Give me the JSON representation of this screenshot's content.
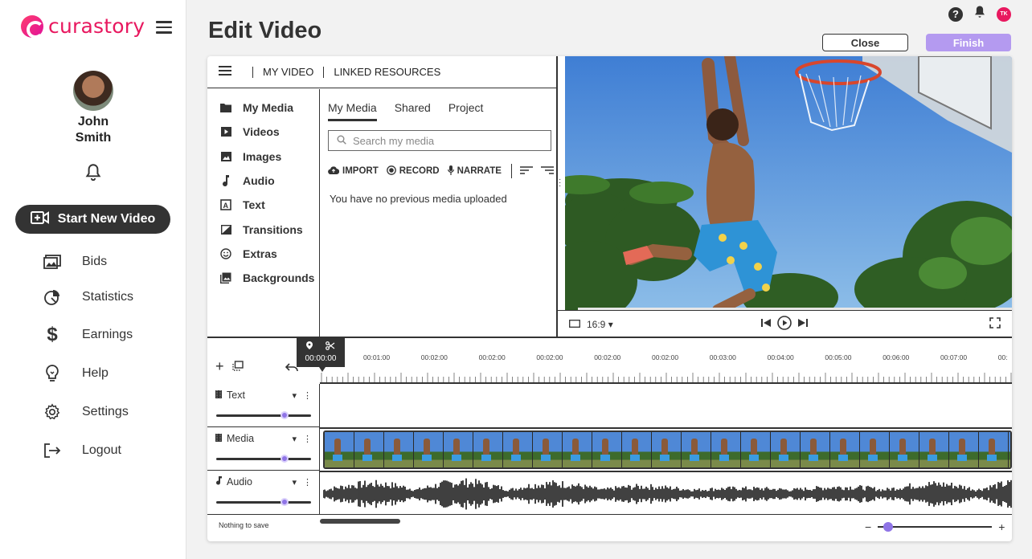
{
  "app": {
    "brand": "curastory",
    "page_title": "Edit Video",
    "brand_color": "#e8185f",
    "accent_color": "#b49af0"
  },
  "user": {
    "first_name": "John",
    "last_name": "Smith",
    "initials": "TK"
  },
  "sidebar": {
    "start_button": "Start New Video",
    "items": [
      {
        "label": "Bids",
        "icon": "images-icon"
      },
      {
        "label": "Statistics",
        "icon": "pie-chart-icon"
      },
      {
        "label": "Earnings",
        "icon": "dollar-icon"
      },
      {
        "label": "Help",
        "icon": "lightbulb-icon"
      },
      {
        "label": "Settings",
        "icon": "gear-icon"
      },
      {
        "label": "Logout",
        "icon": "logout-icon"
      }
    ]
  },
  "header": {
    "close_label": "Close",
    "finish_label": "Finish"
  },
  "media_panel": {
    "nav_tabs": [
      "MY VIDEO",
      "LINKED RESOURCES"
    ],
    "categories": [
      {
        "label": "My Media",
        "icon": "folder-icon"
      },
      {
        "label": "Videos",
        "icon": "play-icon"
      },
      {
        "label": "Images",
        "icon": "image-icon"
      },
      {
        "label": "Audio",
        "icon": "music-note-icon"
      },
      {
        "label": "Text",
        "icon": "text-icon"
      },
      {
        "label": "Transitions",
        "icon": "transition-icon"
      },
      {
        "label": "Extras",
        "icon": "smiley-icon"
      },
      {
        "label": "Backgrounds",
        "icon": "background-icon"
      }
    ],
    "tabs": [
      "My Media",
      "Shared",
      "Project"
    ],
    "active_tab": "My Media",
    "search_placeholder": "Search my media",
    "actions": [
      "IMPORT",
      "RECORD",
      "NARRATE"
    ],
    "empty_message": "You have no previous media uploaded"
  },
  "player": {
    "aspect_ratio": "16:9"
  },
  "timeline": {
    "playhead_time": "00:00:00",
    "ticks": [
      "00:01:00",
      "00:02:00",
      "00:02:00",
      "00:02:00",
      "00:02:00",
      "00:02:00",
      "00:03:00",
      "00:04:00",
      "00:05:00",
      "00:06:00",
      "00:07:00",
      "00:"
    ],
    "tracks": [
      {
        "name": "Text",
        "volume": 0.72
      },
      {
        "name": "Media",
        "volume": 0.72
      },
      {
        "name": "Audio",
        "volume": 0.72
      }
    ],
    "status": "Nothing to save",
    "zoom_level": 0.05
  }
}
